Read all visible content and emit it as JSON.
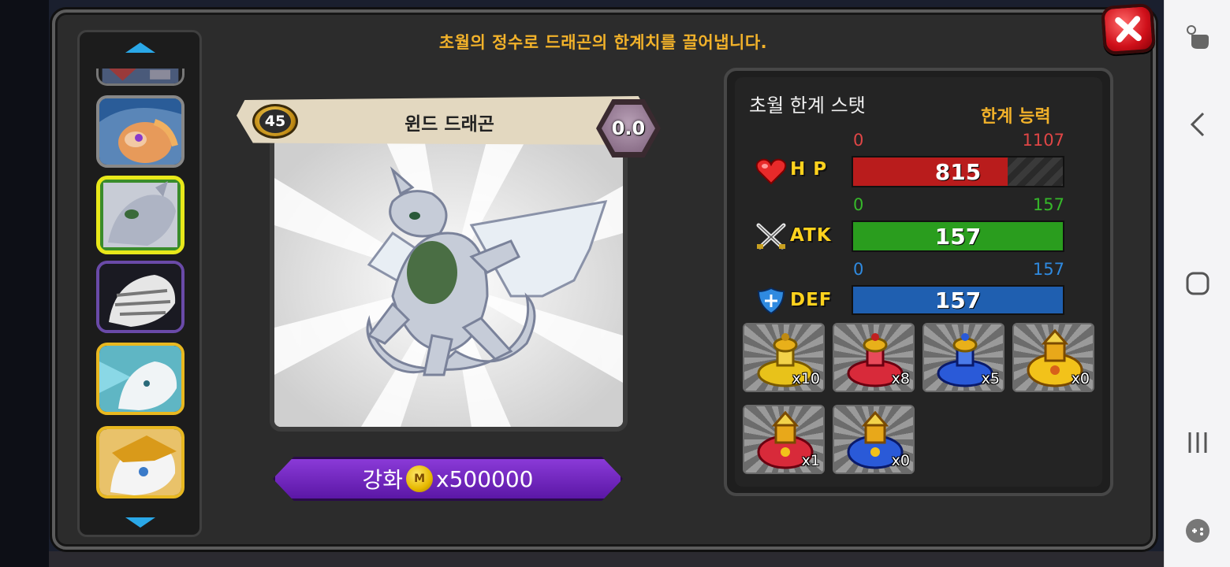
{
  "dialog": {
    "title": "초월의 정수로 드래곤의 한계치를 끌어냅니다."
  },
  "sidebar": {
    "slots": [
      {
        "name": "partial-dragon-top",
        "selected": false
      },
      {
        "name": "blue-orange-dragon",
        "selected": false
      },
      {
        "name": "wind-dragon",
        "selected": true
      },
      {
        "name": "bone-dragon",
        "selected": false
      },
      {
        "name": "white-ice-dragon",
        "selected": false
      },
      {
        "name": "golden-armored-dragon",
        "selected": false
      }
    ]
  },
  "dragon": {
    "level": "45",
    "name": "윈드 드래곤",
    "grade": "0.0"
  },
  "enhance": {
    "label": "강화",
    "coin_symbol": "M",
    "cost": "x500000"
  },
  "stats_panel": {
    "title": "초월 한계 스탯",
    "limit_label": "한계 능력",
    "stats": [
      {
        "key": "hp",
        "label": "H P",
        "min": "0",
        "max": "1107",
        "value": "815",
        "fraction": 0.736,
        "color": "#b91c1c",
        "range_color": "#e04646"
      },
      {
        "key": "atk",
        "label": "ATK",
        "min": "0",
        "max": "157",
        "value": "157",
        "fraction": 1.0,
        "color": "#2a9d1e",
        "range_color": "#36b82a"
      },
      {
        "key": "def",
        "label": "DEF",
        "min": "0",
        "max": "157",
        "value": "157",
        "fraction": 1.0,
        "color": "#1f5fb0",
        "range_color": "#2f8ae0"
      }
    ]
  },
  "items": [
    {
      "name": "yellow-essence",
      "count": "x10"
    },
    {
      "name": "red-essence",
      "count": "x8"
    },
    {
      "name": "blue-essence",
      "count": "x5"
    },
    {
      "name": "golden-essence",
      "count": "x0"
    },
    {
      "name": "golden-red-essence",
      "count": "x1"
    },
    {
      "name": "golden-blue-essence",
      "count": "x0"
    }
  ]
}
